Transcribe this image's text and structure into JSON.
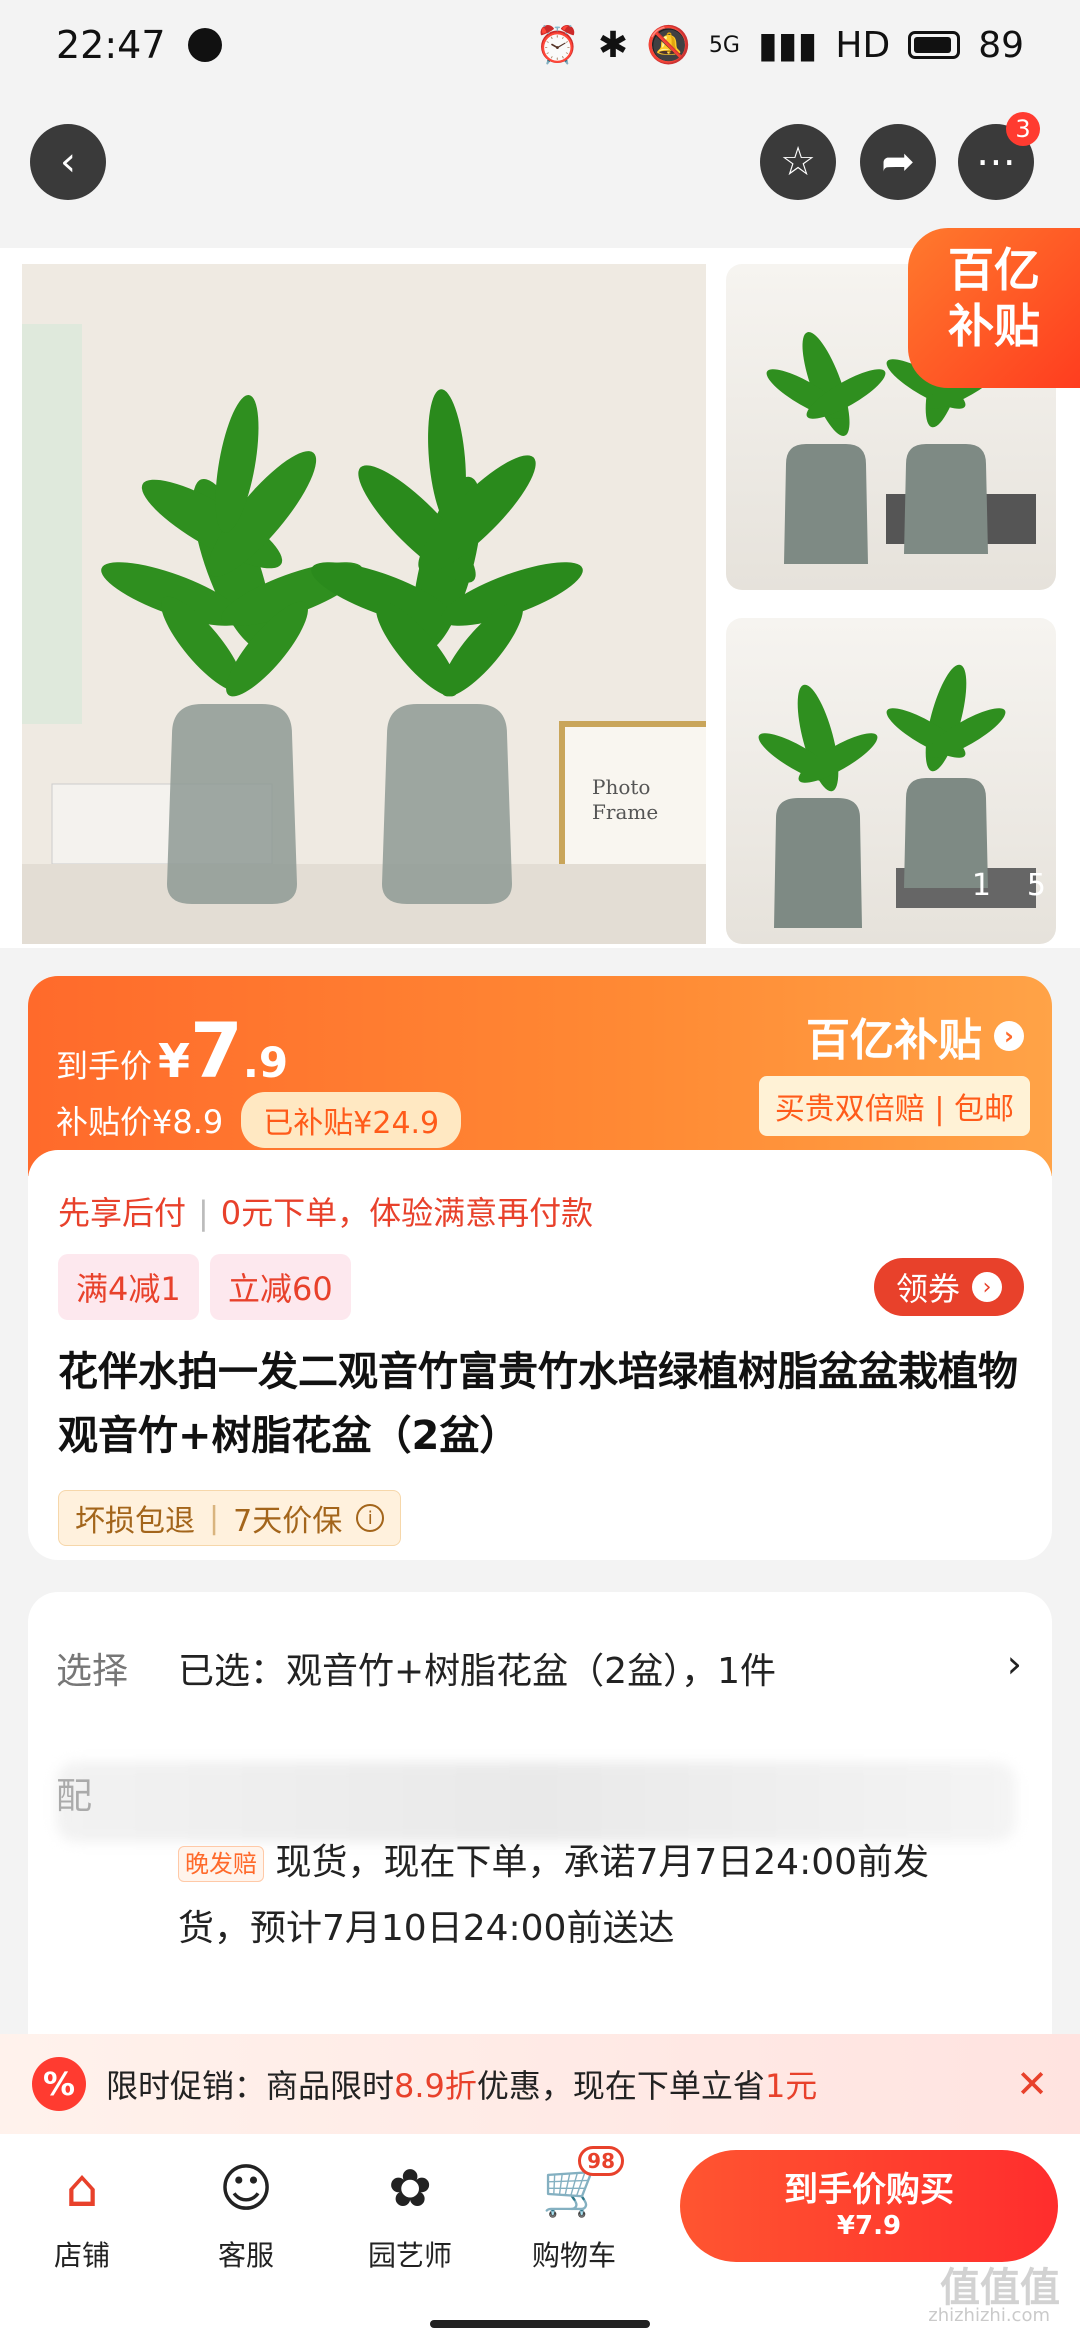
{
  "status_bar": {
    "time": "22:47",
    "network": "5G",
    "hd": "HD",
    "battery": "89"
  },
  "top_nav": {
    "more_badge": "3"
  },
  "gallery": {
    "page_current": "1",
    "page_total": "5",
    "subsidy_tag_line1": "百亿",
    "subsidy_tag_line2": "补贴"
  },
  "price": {
    "final_label": "到手价",
    "currency": "¥",
    "final_int": "7",
    "final_dec": ".9",
    "subsidy_price": "补贴价¥8.9",
    "subsidized": "已补贴¥24.9",
    "program": "百亿补贴",
    "guarantee": "买贵双倍赔 | 包邮"
  },
  "info": {
    "bnpl_a": "先享后付",
    "bnpl_b": "0元下单，体验满意再付款",
    "coupons": [
      "满4减1",
      "立减60"
    ],
    "get_coupon": "领券",
    "title": "花伴水拍一发二观音竹富贵竹水培绿植树脂盆盆栽植物 观音竹+树脂花盆（2盆）",
    "service_a": "坏损包退",
    "service_b": "7天价保"
  },
  "select": {
    "label": "选择",
    "value": "已选：观音竹+树脂花盆（2盆），1件",
    "ship_label": "配",
    "late_tag": "晚发赔",
    "ship_text": "现货，现在下单，承诺7月7日24:00前发货，预计7月10日24:00前送达"
  },
  "promo": {
    "prefix": "限时促销：商品限时",
    "discount": "8.9折",
    "middle": "优惠，现在下单立省",
    "save": "1元"
  },
  "bottom": {
    "tabs": [
      {
        "label": "店铺",
        "icon": "store-icon"
      },
      {
        "label": "客服",
        "icon": "chat-icon"
      },
      {
        "label": "园艺师",
        "icon": "gardener-icon"
      },
      {
        "label": "购物车",
        "icon": "cart-icon",
        "count": "98"
      }
    ],
    "buy_label": "到手价购买",
    "buy_price": "¥7.9"
  },
  "watermark": {
    "main": "值值值",
    "sub": "zhizhizhi.com"
  }
}
